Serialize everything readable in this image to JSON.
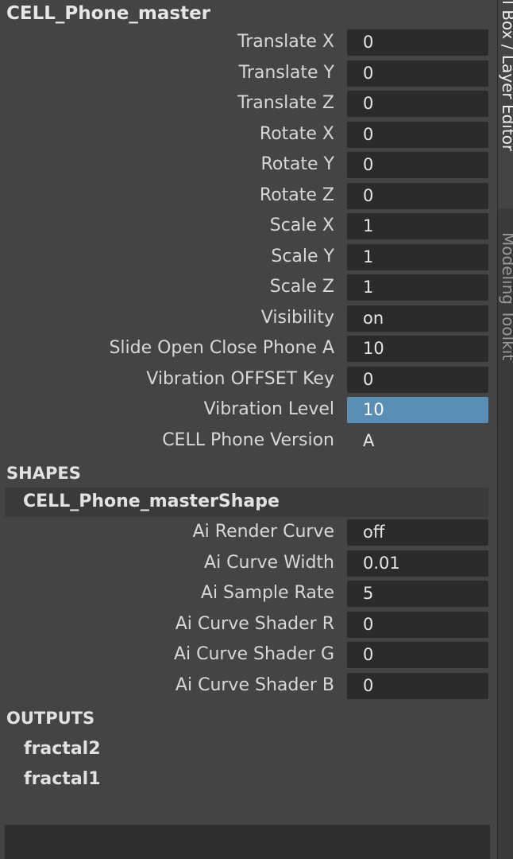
{
  "object_name": "CELL_Phone_master",
  "attributes": [
    {
      "label": "Translate X",
      "value": "0"
    },
    {
      "label": "Translate Y",
      "value": "0"
    },
    {
      "label": "Translate Z",
      "value": "0"
    },
    {
      "label": "Rotate X",
      "value": "0"
    },
    {
      "label": "Rotate Y",
      "value": "0"
    },
    {
      "label": "Rotate Z",
      "value": "0"
    },
    {
      "label": "Scale X",
      "value": "1"
    },
    {
      "label": "Scale Y",
      "value": "1"
    },
    {
      "label": "Scale Z",
      "value": "1"
    },
    {
      "label": "Visibility",
      "value": "on"
    },
    {
      "label": "Slide Open Close Phone A",
      "value": "10"
    },
    {
      "label": "Vibration OFFSET Key",
      "value": "0"
    },
    {
      "label": "Vibration Level",
      "value": "10"
    },
    {
      "label": "CELL Phone Version",
      "value": "A"
    }
  ],
  "shapes": {
    "header": "SHAPES",
    "shape_name": "CELL_Phone_masterShape",
    "attributes": [
      {
        "label": "Ai Render Curve",
        "value": "off"
      },
      {
        "label": "Ai Curve Width",
        "value": "0.01"
      },
      {
        "label": "Ai Sample Rate",
        "value": "5"
      },
      {
        "label": "Ai Curve Shader R",
        "value": "0"
      },
      {
        "label": "Ai Curve Shader G",
        "value": "0"
      },
      {
        "label": "Ai Curve Shader B",
        "value": "0"
      }
    ]
  },
  "outputs": {
    "header": "OUTPUTS",
    "items": [
      "fractal2",
      "fractal1"
    ]
  },
  "side_tabs": {
    "tab1": "el Box / Layer Editor",
    "tab2": "Modeling Toolkit"
  },
  "colors": {
    "panel_bg": "#444444",
    "field_bg": "#2b2b2b",
    "highlight": "#5a8fb5"
  }
}
